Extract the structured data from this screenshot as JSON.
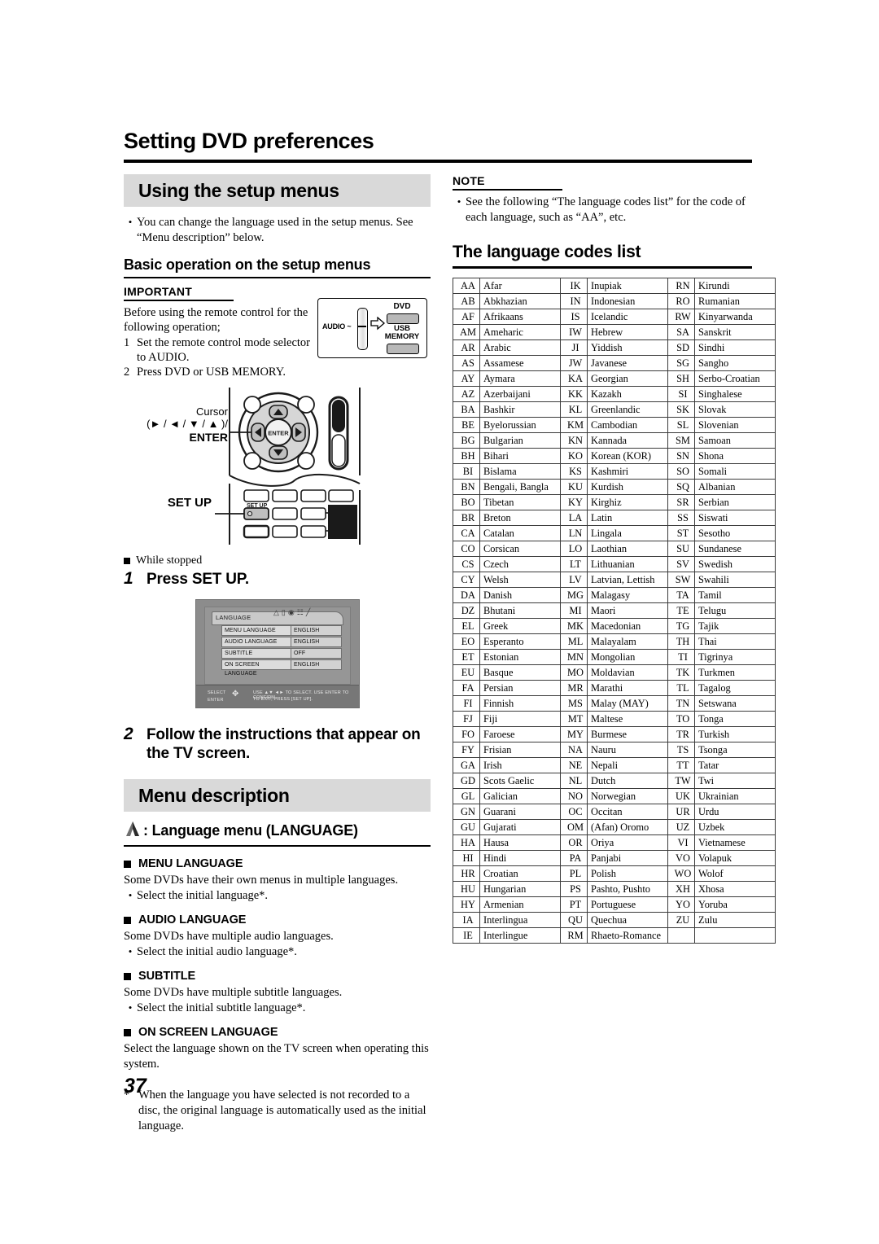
{
  "document": {
    "title": "Setting DVD preferences",
    "page_number": "37"
  },
  "left_column": {
    "banner_setup": "Using the setup menus",
    "intro_bullet": "You can change the language used in the setup menus. See “Menu description” below.",
    "subhead_basic": "Basic operation on the setup menus",
    "important": {
      "title": "IMPORTANT",
      "intro": "Before using the remote control for the following operation;",
      "steps": [
        {
          "num": "1",
          "text": "Set the remote control mode selector to AUDIO."
        },
        {
          "num": "2",
          "text": "Press DVD or USB MEMORY."
        }
      ],
      "graphic": {
        "audio_label": "AUDIO",
        "dvd_label": "DVD",
        "usb_label_line1": "USB",
        "usb_label_line2": "MEMORY"
      }
    },
    "remote": {
      "cursor_label_line1": "Cursor",
      "cursor_label_line2": "(► / ◄ / ▼ / ▲ )/",
      "cursor_label_line3": "ENTER",
      "enter_button": "ENTER",
      "setup_label": "SET UP",
      "setup_button_text": "SET UP"
    },
    "while_stopped": "While stopped",
    "step1": {
      "num": "1",
      "text": "Press SET UP."
    },
    "tv_screen": {
      "tab_label": "LANGUAGE",
      "rows": [
        {
          "key": "MENU LANGUAGE",
          "value": "ENGLISH"
        },
        {
          "key": "AUDIO LANGUAGE",
          "value": "ENGLISH"
        },
        {
          "key": "SUBTITLE",
          "value": "OFF"
        },
        {
          "key": "ON SCREEN LANGUAGE",
          "value": "ENGLISH"
        }
      ],
      "footer_select": "SELECT",
      "footer_enter": "ENTER",
      "footer_line1": "USE ▲▼ ◄► TO SELECT.  USE ENTER TO CONFIRM.",
      "footer_line2": "TO EXIT, PRESS [SET UP]."
    },
    "step2": {
      "num": "2",
      "text": "Follow the instructions that appear on the TV screen."
    },
    "banner_menu_desc": "Menu description",
    "language_menu_head": ": Language menu (LANGUAGE)",
    "items": [
      {
        "head": "MENU LANGUAGE",
        "para": "Some DVDs have their own menus in multiple languages.",
        "bullet": "Select the initial language*."
      },
      {
        "head": "AUDIO LANGUAGE",
        "para": "Some DVDs have multiple audio languages.",
        "bullet": "Select the initial audio language*."
      },
      {
        "head": "SUBTITLE",
        "para": "Some DVDs have multiple subtitle languages.",
        "bullet": "Select the initial subtitle language*."
      },
      {
        "head": "ON SCREEN LANGUAGE",
        "para": "Select the language shown on the TV screen when operating this system.",
        "bullet": ""
      }
    ],
    "footnote": {
      "marker": "*",
      "text": "When the language you have selected is not recorded to a disc, the original language is automatically used as the initial language."
    }
  },
  "right_column": {
    "note": {
      "title": "NOTE",
      "bullet": "See the following “The language codes list” for the code of each language, such as “AA”, etc."
    },
    "codes_title": "The language codes list",
    "codes_table": {
      "col1": [
        [
          "AA",
          "Afar"
        ],
        [
          "AB",
          "Abkhazian"
        ],
        [
          "AF",
          "Afrikaans"
        ],
        [
          "AM",
          "Ameharic"
        ],
        [
          "AR",
          "Arabic"
        ],
        [
          "AS",
          "Assamese"
        ],
        [
          "AY",
          "Aymara"
        ],
        [
          "AZ",
          "Azerbaijani"
        ],
        [
          "BA",
          "Bashkir"
        ],
        [
          "BE",
          "Byelorussian"
        ],
        [
          "BG",
          "Bulgarian"
        ],
        [
          "BH",
          "Bihari"
        ],
        [
          "BI",
          "Bislama"
        ],
        [
          "BN",
          "Bengali, Bangla"
        ],
        [
          "BO",
          "Tibetan"
        ],
        [
          "BR",
          "Breton"
        ],
        [
          "CA",
          "Catalan"
        ],
        [
          "CO",
          "Corsican"
        ],
        [
          "CS",
          "Czech"
        ],
        [
          "CY",
          "Welsh"
        ],
        [
          "DA",
          "Danish"
        ],
        [
          "DZ",
          "Bhutani"
        ],
        [
          "EL",
          "Greek"
        ],
        [
          "EO",
          "Esperanto"
        ],
        [
          "ET",
          "Estonian"
        ],
        [
          "EU",
          "Basque"
        ],
        [
          "FA",
          "Persian"
        ],
        [
          "FI",
          "Finnish"
        ],
        [
          "FJ",
          "Fiji"
        ],
        [
          "FO",
          "Faroese"
        ],
        [
          "FY",
          "Frisian"
        ],
        [
          "GA",
          "Irish"
        ],
        [
          "GD",
          "Scots Gaelic"
        ],
        [
          "GL",
          "Galician"
        ],
        [
          "GN",
          "Guarani"
        ],
        [
          "GU",
          "Gujarati"
        ],
        [
          "HA",
          "Hausa"
        ],
        [
          "HI",
          "Hindi"
        ],
        [
          "HR",
          "Croatian"
        ],
        [
          "HU",
          "Hungarian"
        ],
        [
          "HY",
          "Armenian"
        ],
        [
          "IA",
          "Interlingua"
        ],
        [
          "IE",
          "Interlingue"
        ]
      ],
      "col2": [
        [
          "IK",
          "Inupiak"
        ],
        [
          "IN",
          "Indonesian"
        ],
        [
          "IS",
          "Icelandic"
        ],
        [
          "IW",
          "Hebrew"
        ],
        [
          "JI",
          "Yiddish"
        ],
        [
          "JW",
          "Javanese"
        ],
        [
          "KA",
          "Georgian"
        ],
        [
          "KK",
          "Kazakh"
        ],
        [
          "KL",
          "Greenlandic"
        ],
        [
          "KM",
          "Cambodian"
        ],
        [
          "KN",
          "Kannada"
        ],
        [
          "KO",
          "Korean (KOR)"
        ],
        [
          "KS",
          "Kashmiri"
        ],
        [
          "KU",
          "Kurdish"
        ],
        [
          "KY",
          "Kirghiz"
        ],
        [
          "LA",
          "Latin"
        ],
        [
          "LN",
          "Lingala"
        ],
        [
          "LO",
          "Laothian"
        ],
        [
          "LT",
          "Lithuanian"
        ],
        [
          "LV",
          "Latvian, Lettish"
        ],
        [
          "MG",
          "Malagasy"
        ],
        [
          "MI",
          "Maori"
        ],
        [
          "MK",
          "Macedonian"
        ],
        [
          "ML",
          "Malayalam"
        ],
        [
          "MN",
          "Mongolian"
        ],
        [
          "MO",
          "Moldavian"
        ],
        [
          "MR",
          "Marathi"
        ],
        [
          "MS",
          "Malay (MAY)"
        ],
        [
          "MT",
          "Maltese"
        ],
        [
          "MY",
          "Burmese"
        ],
        [
          "NA",
          "Nauru"
        ],
        [
          "NE",
          "Nepali"
        ],
        [
          "NL",
          "Dutch"
        ],
        [
          "NO",
          "Norwegian"
        ],
        [
          "OC",
          "Occitan"
        ],
        [
          "OM",
          "(Afan) Oromo"
        ],
        [
          "OR",
          "Oriya"
        ],
        [
          "PA",
          "Panjabi"
        ],
        [
          "PL",
          "Polish"
        ],
        [
          "PS",
          "Pashto, Pushto"
        ],
        [
          "PT",
          "Portuguese"
        ],
        [
          "QU",
          "Quechua"
        ],
        [
          "RM",
          "Rhaeto-Romance"
        ]
      ],
      "col3": [
        [
          "RN",
          "Kirundi"
        ],
        [
          "RO",
          "Rumanian"
        ],
        [
          "RW",
          "Kinyarwanda"
        ],
        [
          "SA",
          "Sanskrit"
        ],
        [
          "SD",
          "Sindhi"
        ],
        [
          "SG",
          "Sangho"
        ],
        [
          "SH",
          "Serbo-Croatian"
        ],
        [
          "SI",
          "Singhalese"
        ],
        [
          "SK",
          "Slovak"
        ],
        [
          "SL",
          "Slovenian"
        ],
        [
          "SM",
          "Samoan"
        ],
        [
          "SN",
          "Shona"
        ],
        [
          "SO",
          "Somali"
        ],
        [
          "SQ",
          "Albanian"
        ],
        [
          "SR",
          "Serbian"
        ],
        [
          "SS",
          "Siswati"
        ],
        [
          "ST",
          "Sesotho"
        ],
        [
          "SU",
          "Sundanese"
        ],
        [
          "SV",
          "Swedish"
        ],
        [
          "SW",
          "Swahili"
        ],
        [
          "TA",
          "Tamil"
        ],
        [
          "TE",
          "Telugu"
        ],
        [
          "TG",
          "Tajik"
        ],
        [
          "TH",
          "Thai"
        ],
        [
          "TI",
          "Tigrinya"
        ],
        [
          "TK",
          "Turkmen"
        ],
        [
          "TL",
          "Tagalog"
        ],
        [
          "TN",
          "Setswana"
        ],
        [
          "TO",
          "Tonga"
        ],
        [
          "TR",
          "Turkish"
        ],
        [
          "TS",
          "Tsonga"
        ],
        [
          "TT",
          "Tatar"
        ],
        [
          "TW",
          "Twi"
        ],
        [
          "UK",
          "Ukrainian"
        ],
        [
          "UR",
          "Urdu"
        ],
        [
          "UZ",
          "Uzbek"
        ],
        [
          "VI",
          "Vietnamese"
        ],
        [
          "VO",
          "Volapuk"
        ],
        [
          "WO",
          "Wolof"
        ],
        [
          "XH",
          "Xhosa"
        ],
        [
          "YO",
          "Yoruba"
        ],
        [
          "ZU",
          "Zulu"
        ]
      ]
    }
  },
  "colors": {
    "banner_bg": "#d9d9d9",
    "rule": "#000000",
    "tv_bg": "#8c8c8c"
  }
}
